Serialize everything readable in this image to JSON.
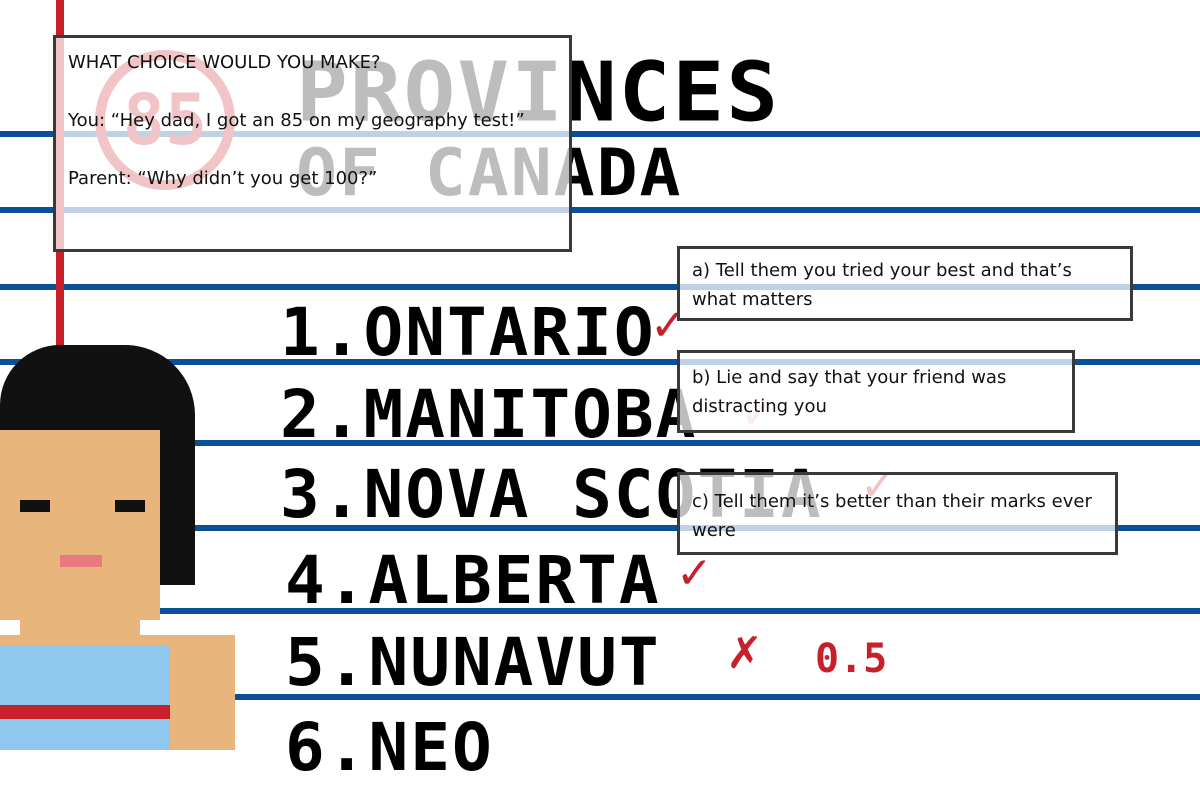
{
  "worksheet": {
    "title_line1": "PROVINCES",
    "title_line2": "OF CANADA",
    "grade_stamp": "85",
    "items": [
      "1.ONTARIO",
      "2.MANITOBA",
      "3.NOVA SCOTIA",
      "4.ALBERTA",
      "5.NUNAVUT",
      "6.NEO"
    ],
    "partial_score": "0.5",
    "check_mark": "✓",
    "cross_mark": "✗"
  },
  "prompt": {
    "heading": "WHAT CHOICE WOULD YOU MAKE?",
    "you_line": "You: “Hey dad, I got an 85 on my geography test!”",
    "parent_line": "Parent: “Why didn’t you get 100?”"
  },
  "choices": [
    {
      "label": "a) Tell them you tried your best and that’s what matters"
    },
    {
      "label": "b) Lie and say that your friend was distracting you"
    },
    {
      "label": "c) Tell them it’s better than their marks ever were"
    }
  ],
  "colors": {
    "rule": "#0a4f9a",
    "margin": "#c8202a",
    "ink": "#000000"
  }
}
